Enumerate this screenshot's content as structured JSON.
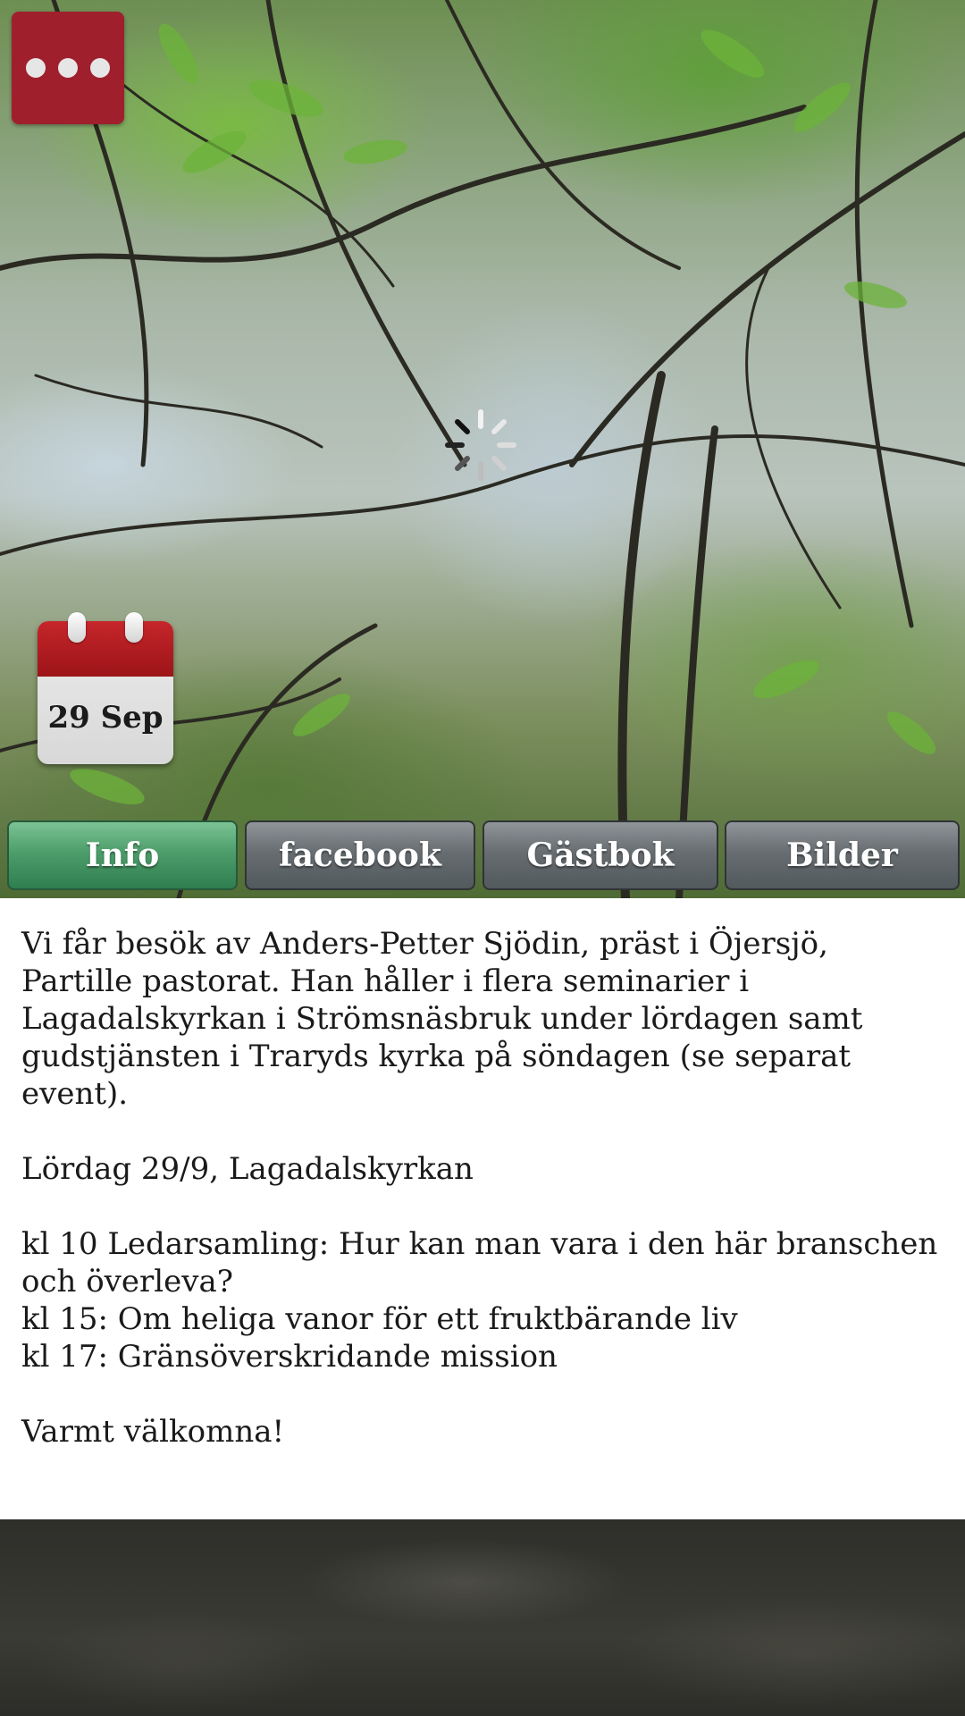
{
  "menu": {
    "icon": "more-dots-icon"
  },
  "loading": {
    "icon": "spinner-icon"
  },
  "calendar": {
    "date": "29 Sep",
    "icon": "calendar-icon"
  },
  "tabs": [
    {
      "label": "Info",
      "active": true
    },
    {
      "label": "facebook",
      "active": false
    },
    {
      "label": "Gästbok",
      "active": false
    },
    {
      "label": "Bilder",
      "active": false
    }
  ],
  "content": {
    "intro": "Vi får besök av Anders-Petter Sjödin, präst i Öjersjö, Partille pastorat. Han håller i flera seminarier i Lagadalskyrkan i Strömsnäsbruk under lördagen samt gudstjänsten i Traryds kyrka på söndagen (se separat event).",
    "day": "Lördag 29/9, Lagadalskyrkan",
    "schedule": [
      "kl 10 Ledarsamling: Hur kan man vara i den här branschen och överleva?",
      "kl 15: Om heliga vanor för ett fruktbärande liv",
      "kl 17: Gränsöverskridande mission"
    ],
    "closing": "Varmt välkomna!"
  },
  "colors": {
    "menu_button": "#a01f2d",
    "tab_active": "#4d9e6b",
    "tab_inactive": "#676d71"
  }
}
